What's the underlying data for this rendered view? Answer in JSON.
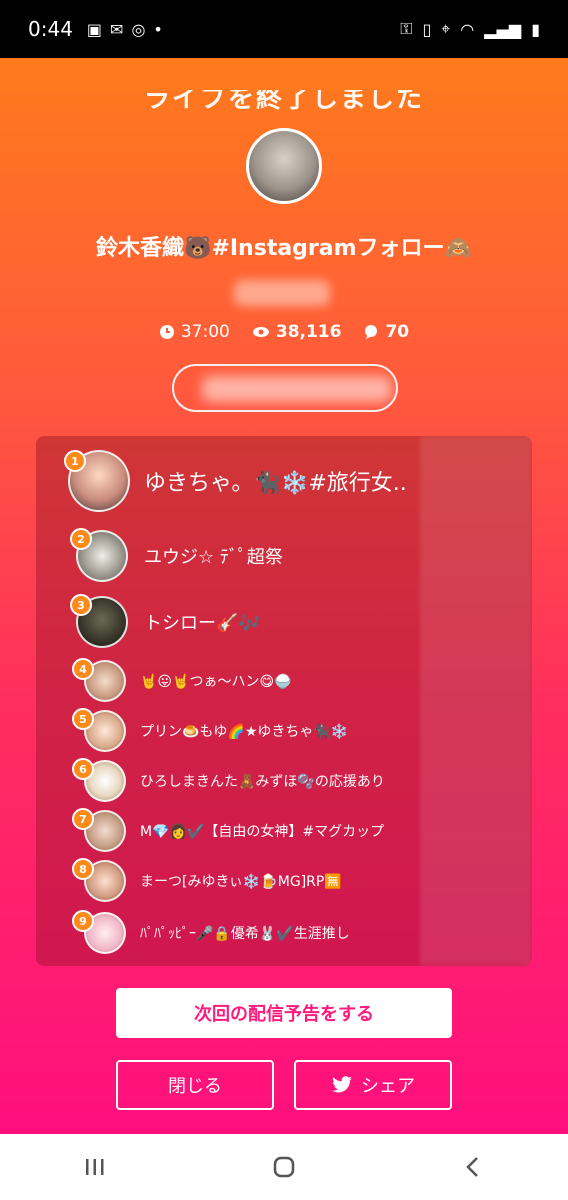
{
  "status_bar": {
    "time": "0:44",
    "left_icons": [
      "image-icon",
      "mail-icon",
      "instagram-icon",
      "dot-icon"
    ],
    "right_icons": [
      "key-icon",
      "battery-saver-icon",
      "location-icon",
      "wifi-icon",
      "signal-icon",
      "battery-icon"
    ]
  },
  "live_end": {
    "banner_text": "ライブを終了しました",
    "host_name": "鈴木香織🐻#Instagramフォロー🙈",
    "stats": {
      "duration": "37:00",
      "viewers": "38,116",
      "comments": "70"
    }
  },
  "ranking": [
    {
      "rank": "1",
      "name": "ゆきちゃ。🐈‍⬛❄️#旅行女.."
    },
    {
      "rank": "2",
      "name": "ユウジ☆ ﾃﾞﾟ超祭"
    },
    {
      "rank": "3",
      "name": "トシロー🎸🎶"
    },
    {
      "rank": "4",
      "name": "🤘😛🤘つぁ〜ハン😋🍚"
    },
    {
      "rank": "5",
      "name": "プリン🍮もゆ🌈★ゆきちゃ🐈‍⬛❄️"
    },
    {
      "rank": "6",
      "name": "ひろしまきんた🧸みずほ🫧の応援あり"
    },
    {
      "rank": "7",
      "name": "M💎👩✔️【自由の女神】#マグカップ"
    },
    {
      "rank": "8",
      "name": "まーつ[みゆきぃ❄️🍺MG]RP🈚"
    },
    {
      "rank": "9",
      "name": "ﾊﾟﾊﾟｯﾋﾟｰ🎤🔒優希🐰✔️生涯推し"
    }
  ],
  "buttons": {
    "preview": "次回の配信予告をする",
    "close": "閉じる",
    "share": "シェア"
  },
  "colors": {
    "gradient_top": "#ff7a1c",
    "gradient_bottom": "#ff0f7e",
    "accent": "#ff1b7d",
    "rank_badge": "#ff8a1a"
  }
}
